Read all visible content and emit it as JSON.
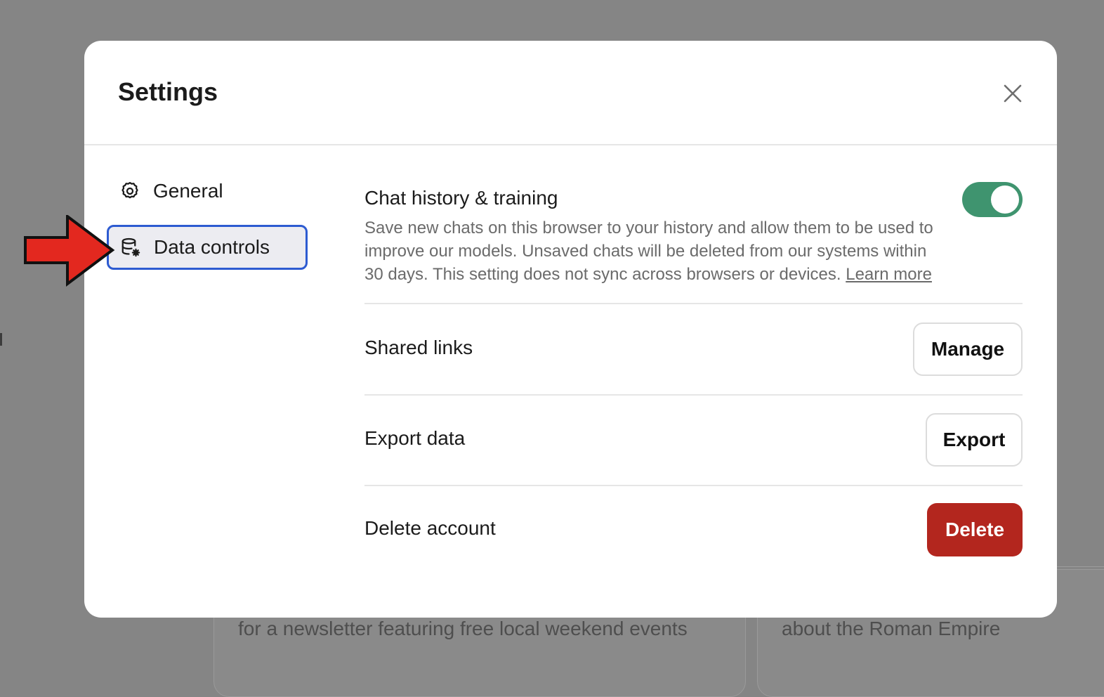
{
  "background": {
    "card_left_text": "for a newsletter featuring free local weekend events",
    "card_right_text": "about the Roman Empire"
  },
  "modal": {
    "title": "Settings",
    "close_icon": "close-icon"
  },
  "sidebar": {
    "items": [
      {
        "label": "General",
        "icon": "gear-icon",
        "selected": false
      },
      {
        "label": "Data controls",
        "icon": "database-gear-icon",
        "selected": true
      }
    ]
  },
  "settings": {
    "chat_history": {
      "title": "Chat history & training",
      "description": "Save new chats on this browser to your history and allow them to be used to improve our models. Unsaved chats will be deleted from our systems within 30 days. This setting does not sync across browsers or devices.",
      "link": "Learn more",
      "enabled": true
    },
    "shared_links": {
      "title": "Shared links",
      "button": "Manage"
    },
    "export_data": {
      "title": "Export data",
      "button": "Export"
    },
    "delete_account": {
      "title": "Delete account",
      "button": "Delete"
    }
  },
  "colors": {
    "toggle_on": "#3f946f",
    "danger": "#b3261e",
    "selection_outline": "#2d5bd1",
    "annotation_arrow": "#e3281f"
  }
}
